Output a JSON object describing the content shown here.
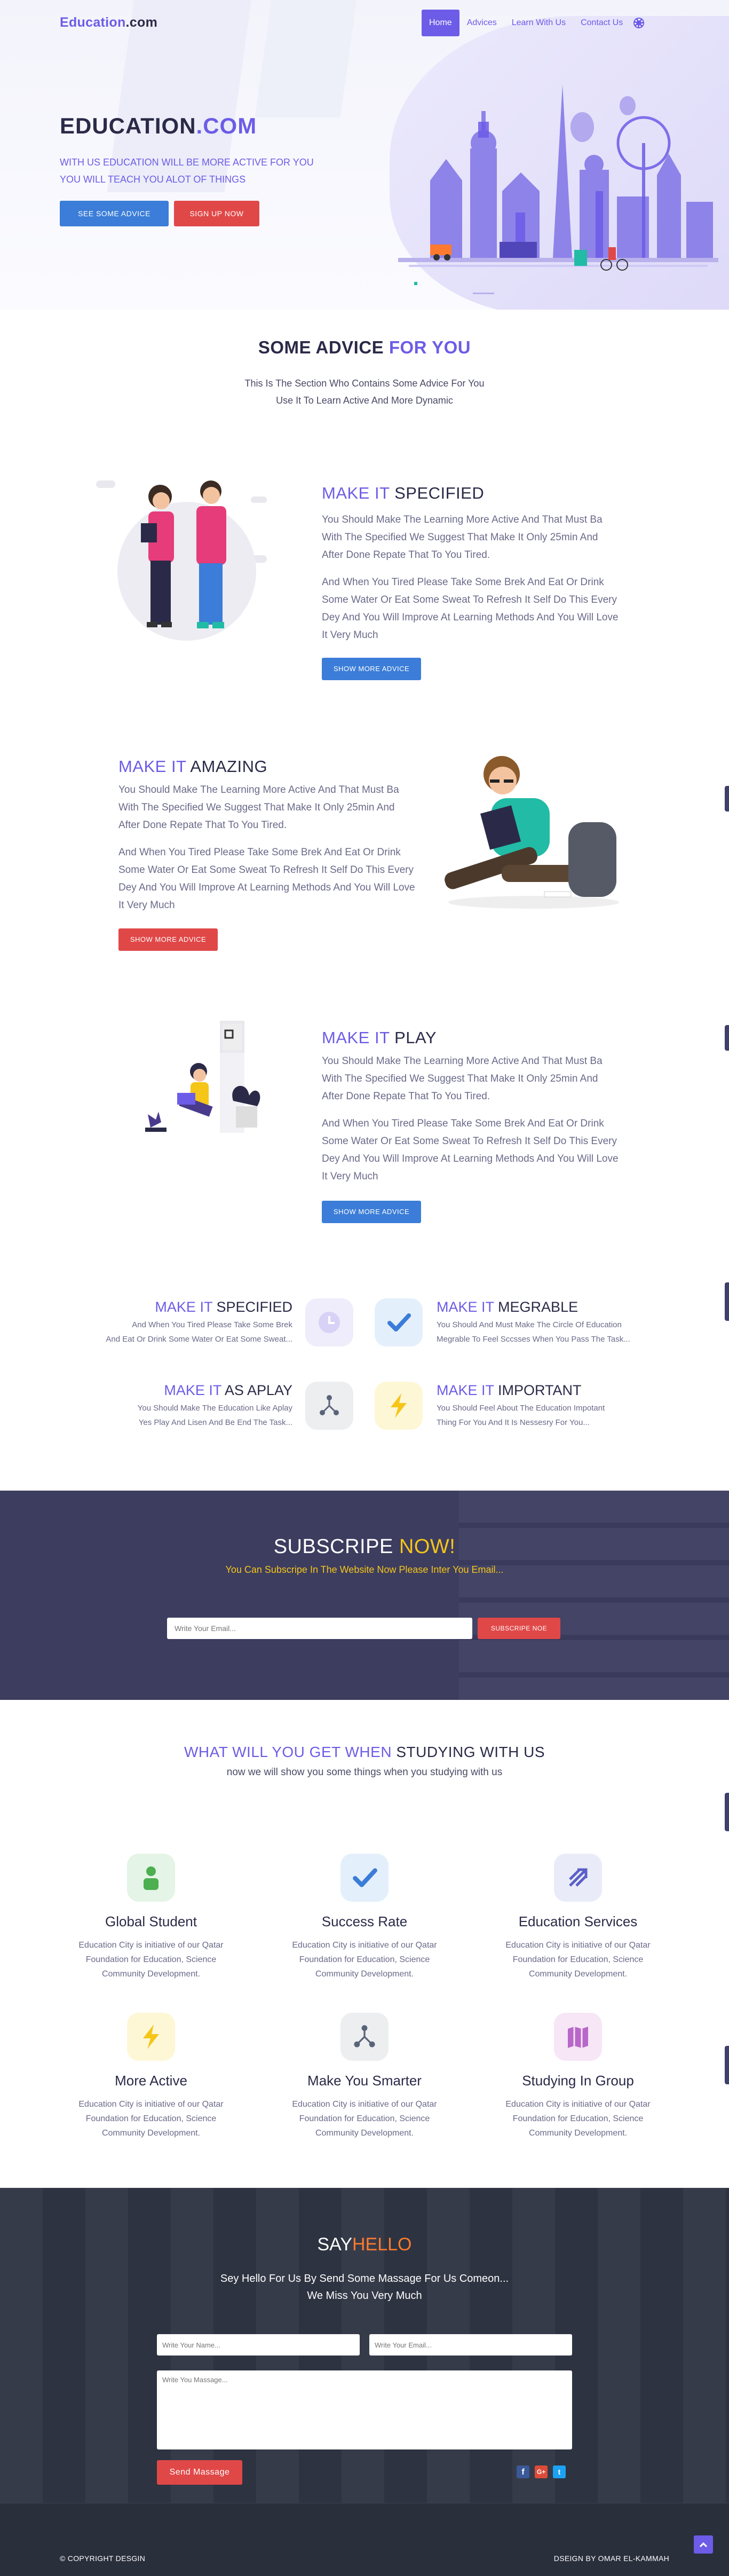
{
  "colors": {
    "accent": "#6c5ce7",
    "blue_button": "#3b7dd8",
    "red_button": "#e04848",
    "subscribe_bg": "#3d3d60",
    "footer_bg": "#2c3240",
    "highlight_orange": "#ff7a2e",
    "yellow": "#f5c518"
  },
  "nav": {
    "brand_main": "Education",
    "brand_suffix": ".com",
    "items": [
      "Home",
      "Advices",
      "Learn With Us",
      "Contact Us"
    ],
    "active": "Home"
  },
  "hero": {
    "title_main": "EDUCATION",
    "title_suffix": ".COM",
    "subtitle_line1": "WITH US EDUCATION WILL BE MORE ACTIVE FOR YOU",
    "subtitle_line2": "YOU WILL TEACH YOU ALOT OF THINGS",
    "btn_primary": "SEE SOME ADVICE",
    "btn_secondary": "SIGN UP NOW"
  },
  "advice": {
    "title_dark": "SOME ADVICE",
    "title_accent": "FOR YOU",
    "desc_line1": "This Is The Section Who Contains Some Advice For You",
    "desc_line2": "Use It To Learn Active And More Dynamic"
  },
  "blocks": [
    {
      "title_accent": "MAKE IT",
      "title_dark": "SPECIFIED",
      "p1": "You Should Make The Learning More Active And That Must Ba With The Specified We Suggest That Make It Only 25min And After Done Repate That To You Tired.",
      "p2": "And When You Tired Please Take Some Brek And Eat Or Drink Some Water Or Eat Some Sweat To Refresh It Self Do This Every Dey And You Will Improve At Learning Methods And You Will Love It Very Much",
      "btn": "SHOW MORE ADVICE"
    },
    {
      "title_accent": "MAKE IT",
      "title_dark": "AMAZING",
      "p1": "You Should Make The Learning More Active And That Must Ba With The Specified We Suggest That Make It Only 25min And After Done Repate That To You Tired.",
      "p2": "And When You Tired Please Take Some Brek And Eat Or Drink Some Water Or Eat Some Sweat To Refresh It Self Do This Every Dey And You Will Improve At Learning Methods And You Will Love It Very Much",
      "btn": "SHOW MORE ADVICE"
    },
    {
      "title_accent": "MAKE IT",
      "title_dark": "PLAY",
      "p1": "You Should Make The Learning More Active And That Must Ba With The Specified We Suggest That Make It Only 25min And After Done Repate That To You Tired.",
      "p2": "And When You Tired Please Take Some Brek And Eat Or Drink Some Water Or Eat Some Sweat To Refresh It Self Do This Every Dey And You Will Improve At Learning Methods And You Will Love It Very Much",
      "btn": "SHOW MORE ADVICE"
    }
  ],
  "features": [
    {
      "title_accent": "MAKE IT",
      "title_dark": "SPECIFIED",
      "l1": "And When You Tired Please Take Some Brek",
      "l2": "And Eat Or Drink Some Water Or Eat Some Sweat...",
      "icon": "clock-icon"
    },
    {
      "title_accent": "MAKE IT",
      "title_dark": "MEGRABLE",
      "l1": "You Should And Must Make The Circle Of Education",
      "l2": "Megrable To Feel Sccsses When You Pass The Task...",
      "icon": "check-icon"
    },
    {
      "title_accent": "MAKE IT",
      "title_dark": "AS APLAY",
      "l1": "You Should Make The Education Like Aplay",
      "l2": "Yes Play And Lisen And Be End The Task...",
      "icon": "share-icon"
    },
    {
      "title_accent": "MAKE IT",
      "title_dark": "IMPORTANT",
      "l1": "You Should Feel About The Education Impotant",
      "l2": "Thing For You And It Is Nessesry For You...",
      "icon": "bolt-icon"
    }
  ],
  "subscribe": {
    "title_main": "SUBSCRIPE",
    "title_accent": "NOW!",
    "subtitle": "You Can Subscripe In The Website Now Please Inter You Email...",
    "placeholder": "Write Your Email...",
    "btn": "SUBSCRIPE NOE"
  },
  "benefits": {
    "title_accent": "WHAT WILL YOU GET WHEN",
    "title_dark": "STUDYING WITH US",
    "subtitle": "now we will show you some things when you studying with us",
    "cards": [
      {
        "title": "Global Student",
        "l1": "Education City is initiative of our Qatar",
        "l2": "Foundation for Education, Science",
        "l3": "Community Development.",
        "icon": "user-icon"
      },
      {
        "title": "Success Rate",
        "l1": "Education City is initiative of our Qatar",
        "l2": "Foundation for Education, Science",
        "l3": "Community Development.",
        "icon": "check-icon"
      },
      {
        "title": "Education Services",
        "l1": "Education City is initiative of our Qatar",
        "l2": "Foundation for Education, Science",
        "l3": "Community Development.",
        "icon": "arrows-icon"
      },
      {
        "title": "More Active",
        "l1": "Education City is initiative of our Qatar",
        "l2": "Foundation for Education, Science",
        "l3": "Community Development.",
        "icon": "bolt-icon"
      },
      {
        "title": "Make You Smarter",
        "l1": "Education City is initiative of our Qatar",
        "l2": "Foundation for Education, Science",
        "l3": "Community Development.",
        "icon": "share-icon"
      },
      {
        "title": "Studying In Group",
        "l1": "Education City is initiative of our Qatar",
        "l2": "Foundation for Education, Science",
        "l3": "Community Development.",
        "icon": "map-icon"
      }
    ]
  },
  "contact": {
    "title_main": "SAY",
    "title_accent": "HELLO",
    "line1": "Sey Hello For Us By Send Some Massage For Us Comeon...",
    "line2": "We Miss You Very Much",
    "name_placeholder": "Write Your Name...",
    "email_placeholder": "Write Your Email...",
    "message_placeholder": "Write You Massage...",
    "btn": "Send Massage",
    "social": [
      "facebook-icon",
      "google-plus-icon",
      "twitter-icon"
    ]
  },
  "footer": {
    "copyright": "© COPYRIGHT DESGIN",
    "credit": "DSEIGN BY OMAR EL-KAMMAH"
  }
}
